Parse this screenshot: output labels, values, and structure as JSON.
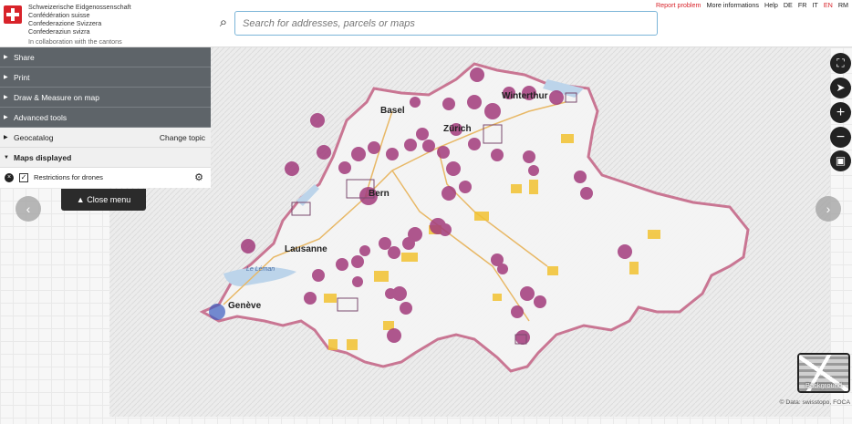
{
  "header": {
    "confederation_lines": [
      "Schweizerische Eidgenossenschaft",
      "Confédération suisse",
      "Confederazione Svizzera",
      "Confederaziun svizra"
    ],
    "collaboration": "In collaboration with the cantons",
    "search_placeholder": "Search for addresses, parcels or maps",
    "links": {
      "report_problem": "Report problem",
      "more_info": "More informations",
      "help": "Help",
      "langs": [
        "DE",
        "FR",
        "IT",
        "EN",
        "RM"
      ],
      "active_lang": "EN"
    }
  },
  "menu": {
    "items": [
      "Share",
      "Print",
      "Draw & Measure on map",
      "Advanced tools"
    ],
    "geocatalog": "Geocatalog",
    "change_topic": "Change topic",
    "maps_displayed": "Maps displayed",
    "layer_name": "Restrictions for drones",
    "close_menu": "Close menu"
  },
  "map": {
    "cities": [
      "Basel",
      "Winterthur",
      "Zürich",
      "Bern",
      "Lausanne",
      "Genève"
    ],
    "lake_label": "Le Léman",
    "zone_color": "#a23b7c",
    "area_color": "#f2c230",
    "border_color": "#c8708f"
  },
  "controls": {
    "icons": [
      "fullscreen-icon",
      "locate-icon",
      "zoom-in-icon",
      "zoom-out-icon",
      "3d-icon"
    ],
    "background_label": "Background",
    "copyright": "© Data: swisstopo, FOCA"
  }
}
